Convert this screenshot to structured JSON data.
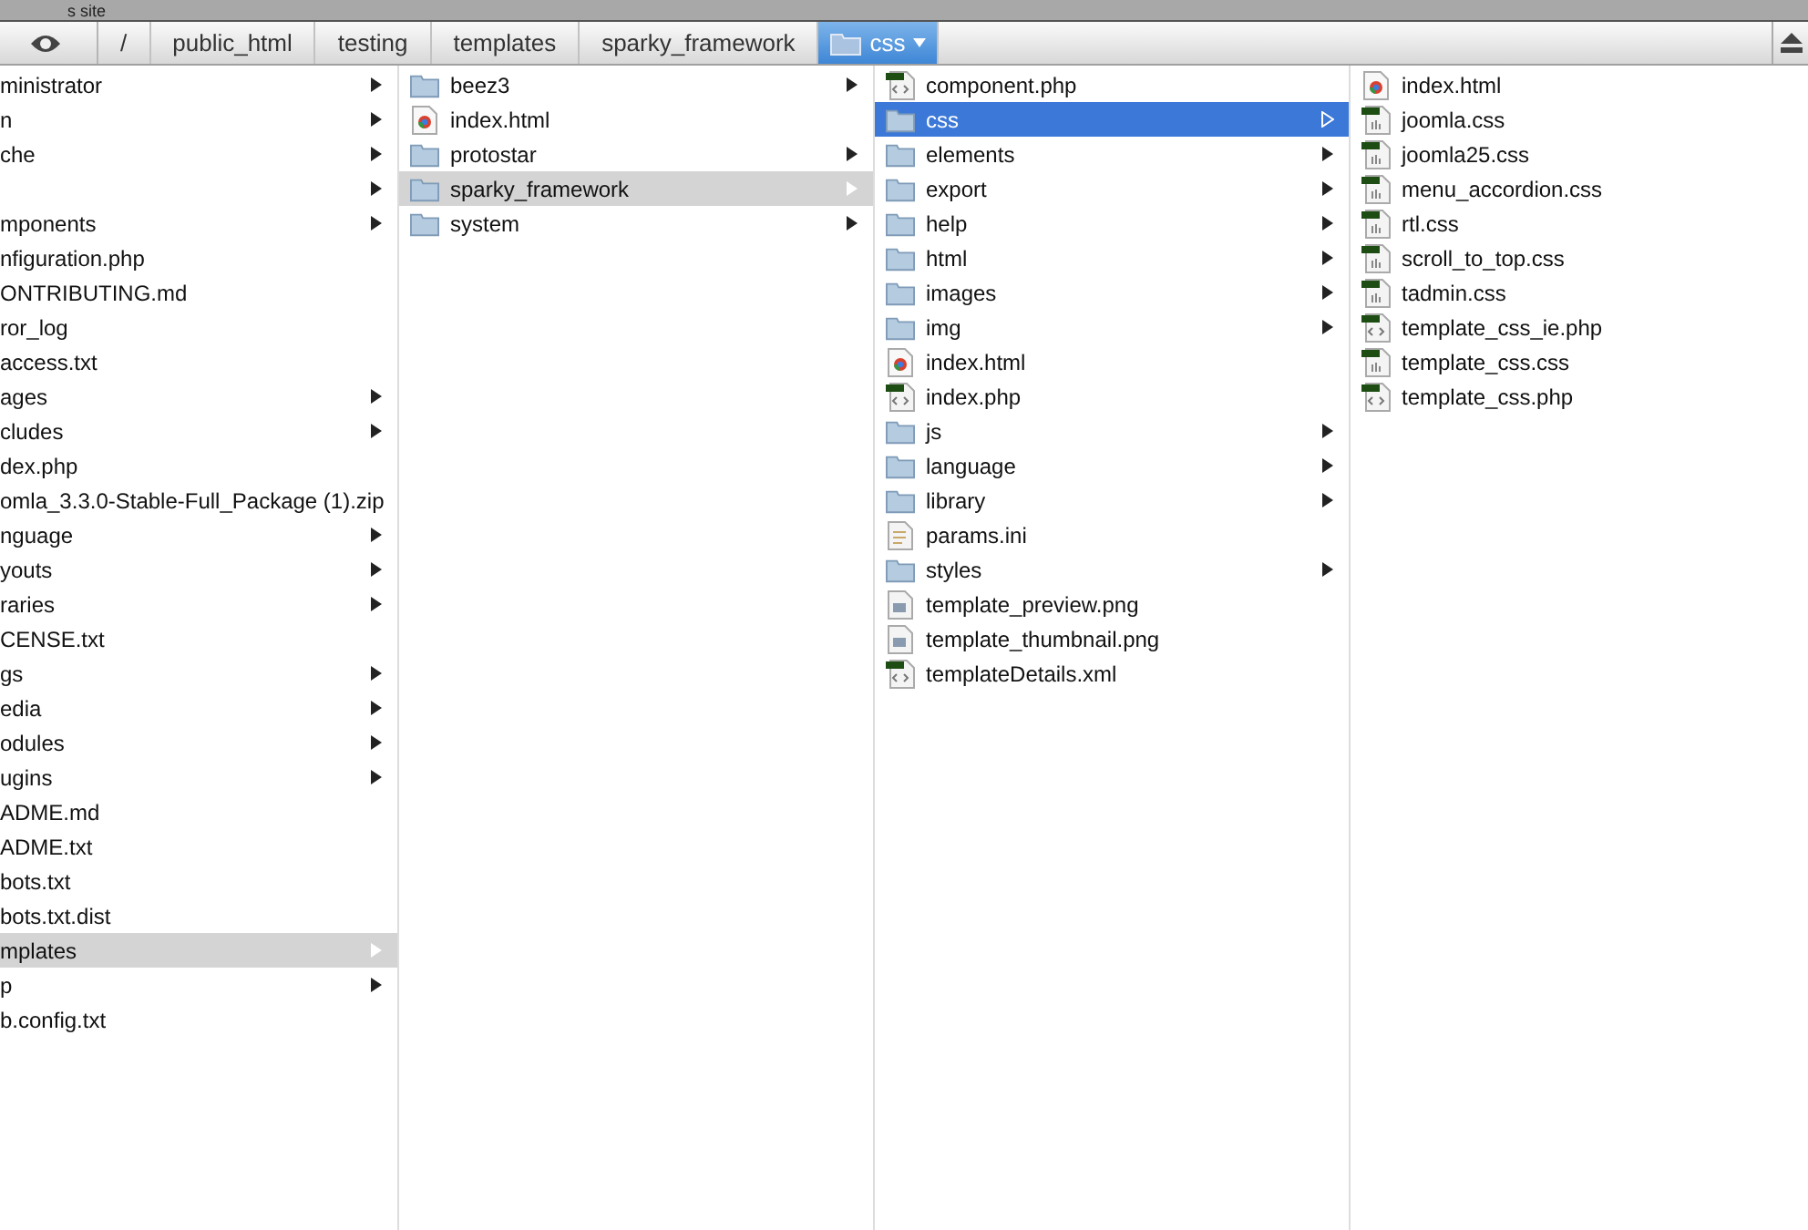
{
  "top_strip": {
    "text": "s site"
  },
  "breadcrumb": [
    {
      "label": "/",
      "selected": false
    },
    {
      "label": "public_html",
      "selected": false
    },
    {
      "label": "testing",
      "selected": false
    },
    {
      "label": "templates",
      "selected": false
    },
    {
      "label": "sparky_framework",
      "selected": false
    },
    {
      "label": "css",
      "selected": true
    }
  ],
  "columns": [
    {
      "items": [
        {
          "label": "ministrator",
          "kind": "folder",
          "selected": false
        },
        {
          "label": "n",
          "kind": "folder",
          "selected": false
        },
        {
          "label": "che",
          "kind": "folder",
          "selected": false
        },
        {
          "kind": "folder",
          "selected": false
        },
        {
          "label": "mponents",
          "kind": "folder",
          "selected": false
        },
        {
          "label": "nfiguration.php",
          "kind": "php",
          "selected": false
        },
        {
          "label": "ONTRIBUTING.md",
          "kind": "file",
          "selected": false
        },
        {
          "label": "ror_log",
          "kind": "file",
          "selected": false
        },
        {
          "label": "access.txt",
          "kind": "file",
          "selected": false
        },
        {
          "label": "ages",
          "kind": "folder",
          "selected": false
        },
        {
          "label": "cludes",
          "kind": "folder",
          "selected": false
        },
        {
          "label": "dex.php",
          "kind": "php",
          "selected": false
        },
        {
          "label": "omla_3.3.0-Stable-Full_Package (1).zip",
          "kind": "file",
          "selected": false
        },
        {
          "label": "nguage",
          "kind": "folder",
          "selected": false
        },
        {
          "label": "youts",
          "kind": "folder",
          "selected": false
        },
        {
          "label": "raries",
          "kind": "folder",
          "selected": false
        },
        {
          "label": "CENSE.txt",
          "kind": "file",
          "selected": false
        },
        {
          "label": "gs",
          "kind": "folder",
          "selected": false
        },
        {
          "label": "edia",
          "kind": "folder",
          "selected": false
        },
        {
          "label": "odules",
          "kind": "folder",
          "selected": false
        },
        {
          "label": "ugins",
          "kind": "folder",
          "selected": false
        },
        {
          "label": "ADME.md",
          "kind": "file",
          "selected": false
        },
        {
          "label": "ADME.txt",
          "kind": "file",
          "selected": false
        },
        {
          "label": "bots.txt",
          "kind": "file",
          "selected": false
        },
        {
          "label": "bots.txt.dist",
          "kind": "file",
          "selected": false
        },
        {
          "label": "mplates",
          "kind": "folder",
          "selected": true
        },
        {
          "label": "p",
          "kind": "folder",
          "selected": false
        },
        {
          "label": "b.config.txt",
          "kind": "file",
          "selected": false
        }
      ]
    },
    {
      "items": [
        {
          "label": "beez3",
          "kind": "folder",
          "selected": false
        },
        {
          "label": "index.html",
          "kind": "html",
          "selected": false
        },
        {
          "label": "protostar",
          "kind": "folder",
          "selected": false
        },
        {
          "label": "sparky_framework",
          "kind": "folder",
          "selected": true
        },
        {
          "label": "system",
          "kind": "folder",
          "selected": false
        }
      ]
    },
    {
      "items": [
        {
          "label": "component.php",
          "kind": "php",
          "selected": false
        },
        {
          "label": "css",
          "kind": "folder",
          "selected": true
        },
        {
          "label": "elements",
          "kind": "folder",
          "selected": false
        },
        {
          "label": "export",
          "kind": "folder",
          "selected": false
        },
        {
          "label": "help",
          "kind": "folder",
          "selected": false
        },
        {
          "label": "html",
          "kind": "folder",
          "selected": false
        },
        {
          "label": "images",
          "kind": "folder",
          "selected": false
        },
        {
          "label": "img",
          "kind": "folder",
          "selected": false
        },
        {
          "label": "index.html",
          "kind": "html",
          "selected": false
        },
        {
          "label": "index.php",
          "kind": "php",
          "selected": false
        },
        {
          "label": "js",
          "kind": "folder",
          "selected": false
        },
        {
          "label": "language",
          "kind": "folder",
          "selected": false
        },
        {
          "label": "library",
          "kind": "folder",
          "selected": false
        },
        {
          "label": "params.ini",
          "kind": "ini",
          "selected": false
        },
        {
          "label": "styles",
          "kind": "folder",
          "selected": false
        },
        {
          "label": "template_preview.png",
          "kind": "image",
          "selected": false
        },
        {
          "label": "template_thumbnail.png",
          "kind": "image",
          "selected": false
        },
        {
          "label": "templateDetails.xml",
          "kind": "php",
          "selected": false
        }
      ]
    },
    {
      "items": [
        {
          "label": "index.html",
          "kind": "html",
          "selected": false
        },
        {
          "label": "joomla.css",
          "kind": "css",
          "selected": false
        },
        {
          "label": "joomla25.css",
          "kind": "css",
          "selected": false
        },
        {
          "label": "menu_accordion.css",
          "kind": "css",
          "selected": false
        },
        {
          "label": "rtl.css",
          "kind": "css",
          "selected": false
        },
        {
          "label": "scroll_to_top.css",
          "kind": "css",
          "selected": false
        },
        {
          "label": "tadmin.css",
          "kind": "css",
          "selected": false
        },
        {
          "label": "template_css_ie.php",
          "kind": "php",
          "selected": false
        },
        {
          "label": "template_css.css",
          "kind": "css",
          "selected": false
        },
        {
          "label": "template_css.php",
          "kind": "php",
          "selected": false
        }
      ]
    }
  ]
}
